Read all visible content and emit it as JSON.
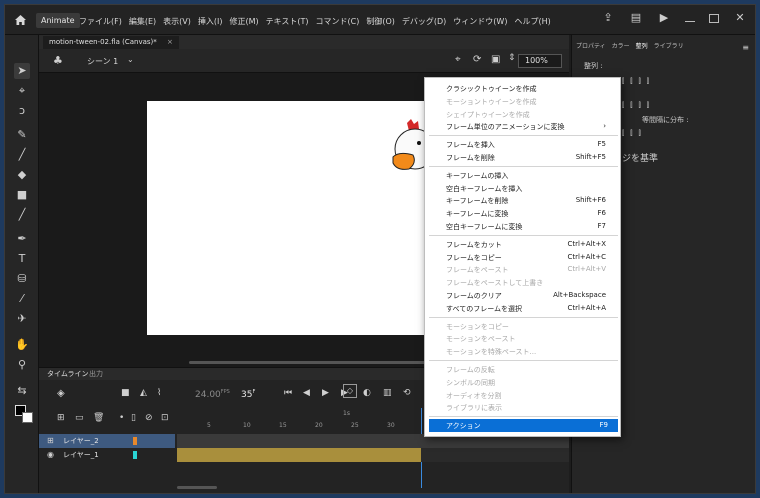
{
  "app": {
    "name": "Animate"
  },
  "menubar": [
    "ファイル(F)",
    "編集(E)",
    "表示(V)",
    "挿入(I)",
    "修正(M)",
    "テキスト(T)",
    "コマンド(C)",
    "制御(O)",
    "デバッグ(D)",
    "ウィンドウ(W)",
    "ヘルプ(H)"
  ],
  "document": {
    "tab": "motion-tween-02.fla (Canvas)*",
    "tab_close": "×",
    "scene": "シーン 1",
    "zoom": "100%"
  },
  "timeline": {
    "tabs": [
      "タイムライン",
      "出力"
    ],
    "fps": "24.00",
    "fps_unit": "FPS",
    "current_frame": "35",
    "current_frame_unit": "F",
    "ruler_ticks": [
      "5",
      "10",
      "15",
      "20",
      "25",
      "30"
    ],
    "ruler_marker": "1s",
    "layers": [
      {
        "name": "レイヤー_2",
        "color": "#e8892c",
        "selected": true
      },
      {
        "name": "レイヤー_1",
        "color": "#2ad4d4",
        "selected": false
      }
    ]
  },
  "right_panel": {
    "tabs": [
      "プロパティ",
      "カラー",
      "整列",
      "ライブラリ"
    ],
    "align_label": "整列 :",
    "distribute_label": "等間隔に分布 :",
    "stage_basis": "ジを基準"
  },
  "context_menu": {
    "groups": [
      [
        {
          "label": "クラシックトゥイーンを作成",
          "shortcut": "",
          "disabled": false
        },
        {
          "label": "モーショントゥイーンを作成",
          "shortcut": "",
          "disabled": true
        },
        {
          "label": "シェイプトゥイーンを作成",
          "shortcut": "",
          "disabled": true
        },
        {
          "label": "フレーム単位のアニメーションに変換",
          "shortcut": "›",
          "disabled": false
        }
      ],
      [
        {
          "label": "フレームを挿入",
          "shortcut": "F5",
          "disabled": false
        },
        {
          "label": "フレームを削除",
          "shortcut": "Shift+F5",
          "disabled": false
        }
      ],
      [
        {
          "label": "キーフレームの挿入",
          "shortcut": "",
          "disabled": false
        },
        {
          "label": "空白キーフレームを挿入",
          "shortcut": "",
          "disabled": false
        },
        {
          "label": "キーフレームを削除",
          "shortcut": "Shift+F6",
          "disabled": false
        },
        {
          "label": "キーフレームに変換",
          "shortcut": "F6",
          "disabled": false
        },
        {
          "label": "空白キーフレームに変換",
          "shortcut": "F7",
          "disabled": false
        }
      ],
      [
        {
          "label": "フレームをカット",
          "shortcut": "Ctrl+Alt+X",
          "disabled": false
        },
        {
          "label": "フレームをコピー",
          "shortcut": "Ctrl+Alt+C",
          "disabled": false
        },
        {
          "label": "フレームをペースト",
          "shortcut": "Ctrl+Alt+V",
          "disabled": true
        },
        {
          "label": "フレームをペーストして上書き",
          "shortcut": "",
          "disabled": true
        },
        {
          "label": "フレームのクリア",
          "shortcut": "Alt+Backspace",
          "disabled": false
        },
        {
          "label": "すべてのフレームを選択",
          "shortcut": "Ctrl+Alt+A",
          "disabled": false
        }
      ],
      [
        {
          "label": "モーションをコピー",
          "shortcut": "",
          "disabled": true
        },
        {
          "label": "モーションをペースト",
          "shortcut": "",
          "disabled": true
        },
        {
          "label": "モーションを特殊ペースト...",
          "shortcut": "",
          "disabled": true
        }
      ],
      [
        {
          "label": "フレームの反転",
          "shortcut": "",
          "disabled": true
        },
        {
          "label": "シンボルの同期",
          "shortcut": "",
          "disabled": true
        },
        {
          "label": "オーディオを分割",
          "shortcut": "",
          "disabled": true
        },
        {
          "label": "ライブラリに表示",
          "shortcut": "",
          "disabled": true
        }
      ],
      [
        {
          "label": "アクション",
          "shortcut": "F9",
          "disabled": false,
          "highlighted": true
        }
      ]
    ]
  },
  "colors": {
    "accent": "#0a6fd6",
    "selected_layer": "#3e5a80",
    "tween_span": "#a98f3c"
  }
}
